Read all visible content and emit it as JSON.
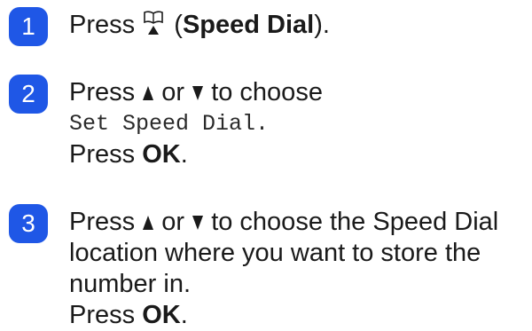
{
  "steps": [
    {
      "number": "1",
      "press": "Press",
      "paren_open": "(",
      "speed_dial_bold": "Speed Dial",
      "paren_close": ").",
      "icon": "speed-dial-book-icon"
    },
    {
      "number": "2",
      "press": "Press",
      "or": "or",
      "to_choose": "to choose",
      "menu_text": "Set Speed Dial.",
      "press_ok": "Press",
      "ok": "OK",
      "period": "."
    },
    {
      "number": "3",
      "press": "Press",
      "or": "or",
      "line1_rest": "to choose the Speed Dial",
      "line2": "location where you want to store the",
      "line3": "number in.",
      "press_ok": "Press",
      "ok": "OK",
      "period": "."
    }
  ],
  "colors": {
    "badge": "#1f57e6",
    "text": "#1a1a1a"
  }
}
